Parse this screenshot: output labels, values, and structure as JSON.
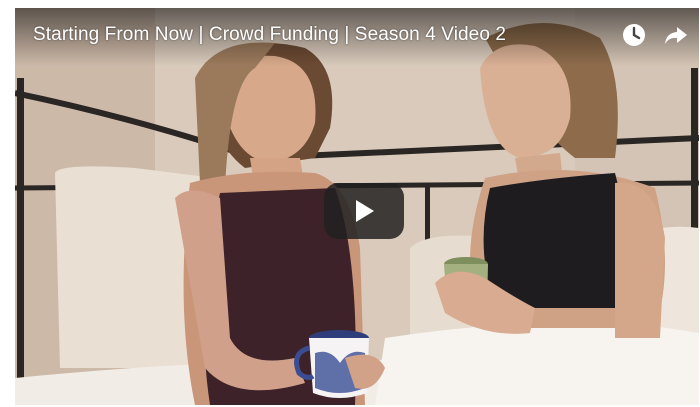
{
  "video": {
    "title": "Starting From Now | Crowd Funding | Season 4 Video 2"
  },
  "controls": {
    "watch_later_icon": "clock-icon",
    "share_icon": "share-arrow-icon",
    "play_icon": "play-icon"
  },
  "colors": {
    "title_text": "#ffffff",
    "play_button_bg": "#212121"
  }
}
